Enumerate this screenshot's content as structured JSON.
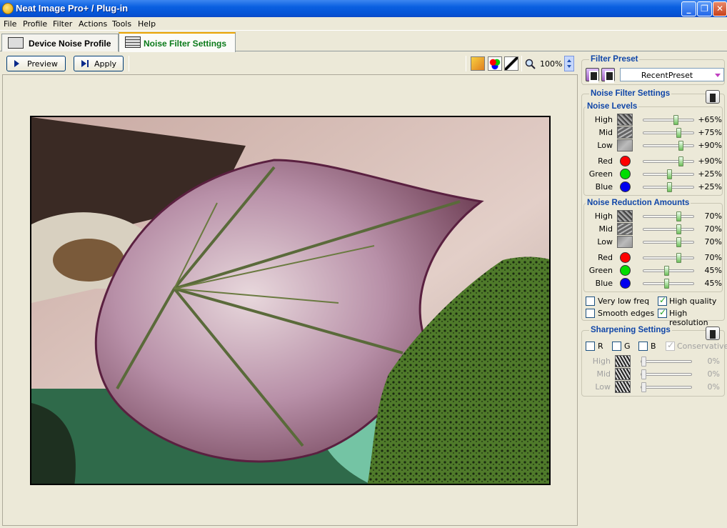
{
  "window": {
    "title": "Neat Image Pro+ / Plug-in"
  },
  "menu": [
    "File",
    "Profile",
    "Filter",
    "Actions",
    "Tools",
    "Help"
  ],
  "tabs": {
    "device": "Device Noise Profile",
    "noise": "Noise Filter Settings"
  },
  "toolbar": {
    "preview": "Preview",
    "apply": "Apply",
    "zoom": "100%"
  },
  "filter_preset": {
    "title": "Filter Preset",
    "selected": "RecentPreset"
  },
  "noise_filter": {
    "title": "Noise Filter Settings",
    "levels_title": "Noise Levels",
    "levels": [
      {
        "label": "High",
        "value": "+65%",
        "pos": 0.65
      },
      {
        "label": "Mid",
        "value": "+75%",
        "pos": 0.7
      },
      {
        "label": "Low",
        "value": "+90%",
        "pos": 0.75
      },
      {
        "label": "Red",
        "value": "+90%",
        "pos": 0.75,
        "color": "#ff0000"
      },
      {
        "label": "Green",
        "value": "+25%",
        "pos": 0.5,
        "color": "#00dd00"
      },
      {
        "label": "Blue",
        "value": "+25%",
        "pos": 0.5,
        "color": "#0000ee"
      }
    ],
    "reduction_title": "Noise Reduction Amounts",
    "reduction": [
      {
        "label": "High",
        "value": "70%",
        "pos": 0.7
      },
      {
        "label": "Mid",
        "value": "70%",
        "pos": 0.7
      },
      {
        "label": "Low",
        "value": "70%",
        "pos": 0.7
      },
      {
        "label": "Red",
        "value": "70%",
        "pos": 0.7,
        "color": "#ff0000"
      },
      {
        "label": "Green",
        "value": "45%",
        "pos": 0.45,
        "color": "#00dd00"
      },
      {
        "label": "Blue",
        "value": "45%",
        "pos": 0.45,
        "color": "#0000ee"
      }
    ],
    "options": {
      "very_low_freq": "Very low freq",
      "smooth_edges": "Smooth edges",
      "high_quality": "High quality",
      "high_resolution": "High resolution"
    }
  },
  "sharpening": {
    "title": "Sharpening Settings",
    "channels": {
      "r": "R",
      "g": "G",
      "b": "B",
      "conservative": "Conservative"
    },
    "rows": [
      {
        "label": "High",
        "value": "0%"
      },
      {
        "label": "Mid",
        "value": "0%"
      },
      {
        "label": "Low",
        "value": "0%"
      }
    ]
  }
}
